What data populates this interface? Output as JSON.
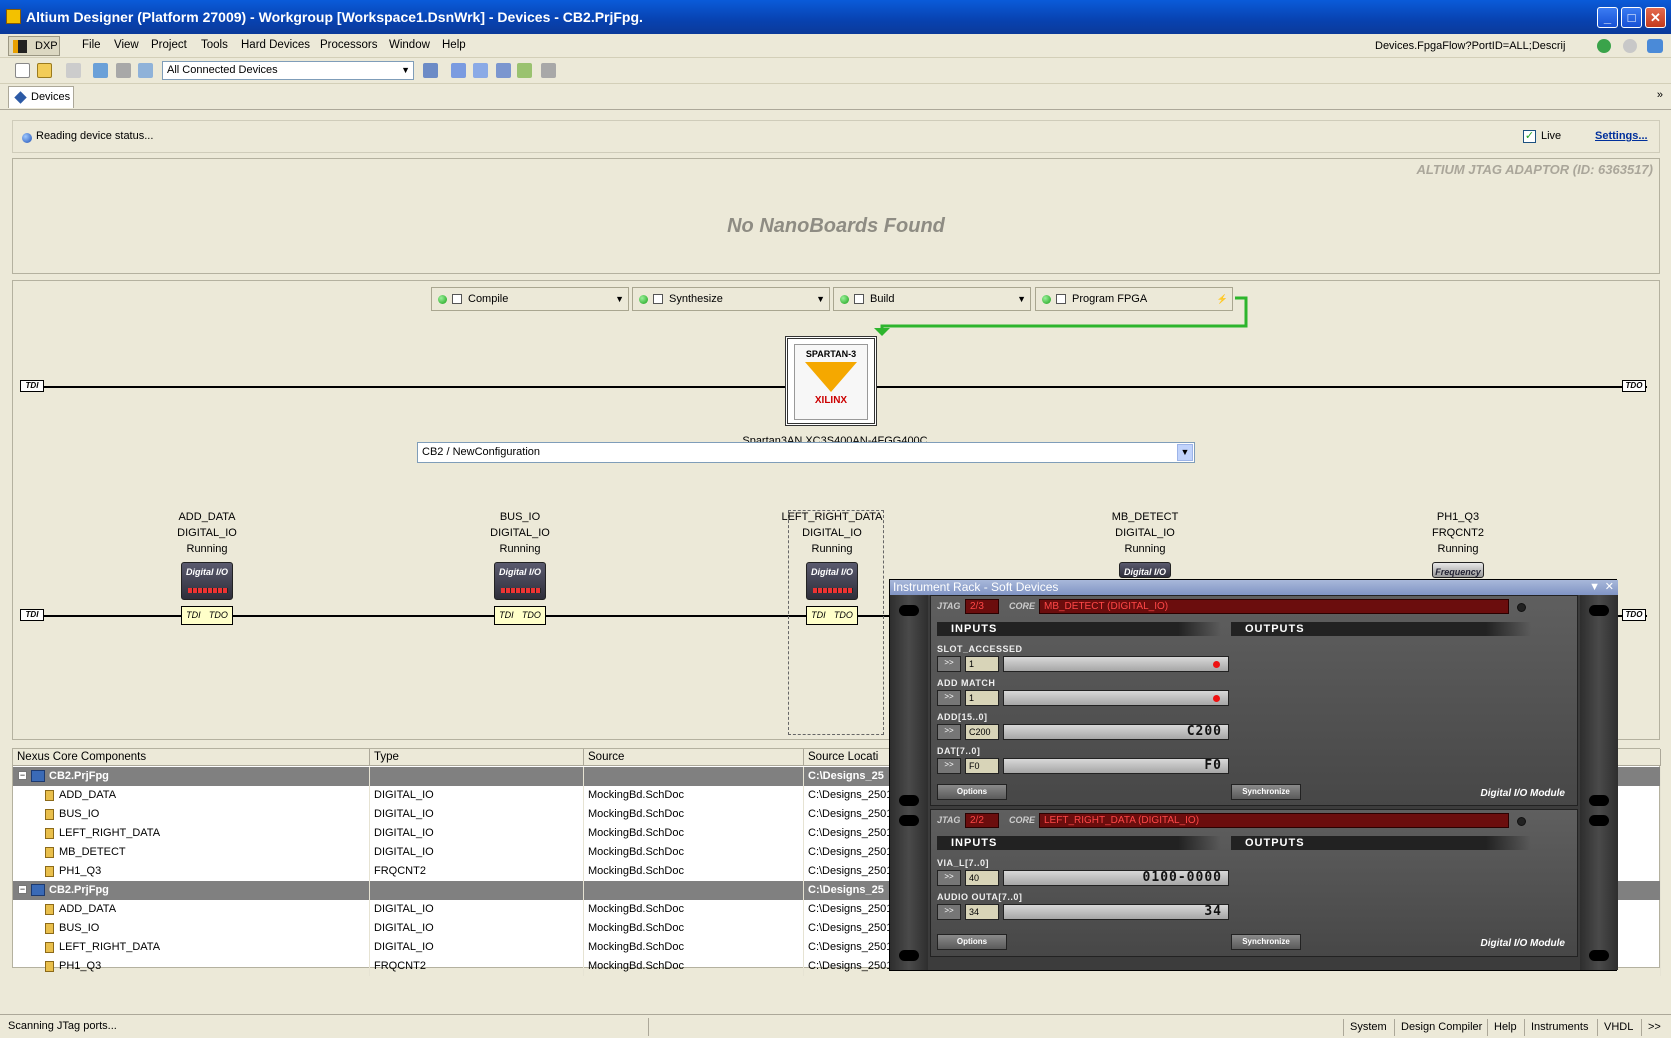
{
  "window": {
    "title": "Altium Designer (Platform 27009) - Workgroup [Workspace1.DsnWrk] - Devices - CB2.PrjFpg."
  },
  "menubar": {
    "dxp": "DXP",
    "items": [
      "File",
      "View",
      "Project",
      "Tools",
      "Hard Devices",
      "Processors",
      "Window",
      "Help"
    ],
    "nav_combo": "Devices.FpgaFlow?PortID=ALL;Descrij"
  },
  "toolbar": {
    "device_filter": "All Connected Devices"
  },
  "tabs": {
    "devices": "Devices"
  },
  "status_strip": {
    "message": "Reading device status...",
    "live_label": "Live",
    "live_checked": "✓",
    "settings": "Settings..."
  },
  "board_panel": {
    "adaptor": "ALTIUM JTAG ADAPTOR (ID: 6363517)",
    "message": "No NanoBoards Found"
  },
  "flow": {
    "compile": "Compile",
    "synthesize": "Synthesize",
    "build": "Build",
    "program": "Program FPGA"
  },
  "chain": {
    "tdi": "TDI",
    "tdo": "TDO"
  },
  "device": {
    "brand": "SPARTAN-3",
    "vendor": "XILINX",
    "name": "Spartan3AN XC3S400AN-4FGG400C",
    "state": "Programmed"
  },
  "configuration": "CB2 / NewConfiguration",
  "cores": [
    {
      "name": "ADD_DATA",
      "type": "DIGITAL_IO",
      "state": "Running",
      "icon": "Digital I/O"
    },
    {
      "name": "BUS_IO",
      "type": "DIGITAL_IO",
      "state": "Running",
      "icon": "Digital I/O"
    },
    {
      "name": "LEFT_RIGHT_DATA",
      "type": "DIGITAL_IO",
      "state": "Running",
      "icon": "Digital I/O"
    },
    {
      "name": "MB_DETECT",
      "type": "DIGITAL_IO",
      "state": "Running",
      "icon": "Digital I/O"
    },
    {
      "name": "PH1_Q3",
      "type": "FRQCNT2",
      "state": "Running",
      "icon": "Frequency"
    }
  ],
  "grid": {
    "headers": [
      "Nexus Core Components",
      "Type",
      "Source",
      "Source Locati"
    ],
    "groups": [
      {
        "name": "CB2.PrjFpg",
        "location": "C:\\Designs_25",
        "rows": [
          {
            "name": "ADD_DATA",
            "type": "DIGITAL_IO",
            "source": "MockingBd.SchDoc",
            "loc": "C:\\Designs_2501"
          },
          {
            "name": "BUS_IO",
            "type": "DIGITAL_IO",
            "source": "MockingBd.SchDoc",
            "loc": "C:\\Designs_2501"
          },
          {
            "name": "LEFT_RIGHT_DATA",
            "type": "DIGITAL_IO",
            "source": "MockingBd.SchDoc",
            "loc": "C:\\Designs_2501"
          },
          {
            "name": "MB_DETECT",
            "type": "DIGITAL_IO",
            "source": "MockingBd.SchDoc",
            "loc": "C:\\Designs_2501"
          },
          {
            "name": "PH1_Q3",
            "type": "FRQCNT2",
            "source": "MockingBd.SchDoc",
            "loc": "C:\\Designs_2501"
          }
        ]
      },
      {
        "name": "CB2.PrjFpg",
        "location": "C:\\Designs_25",
        "rows": [
          {
            "name": "ADD_DATA",
            "type": "DIGITAL_IO",
            "source": "MockingBd.SchDoc",
            "loc": "C:\\Designs_2501"
          },
          {
            "name": "BUS_IO",
            "type": "DIGITAL_IO",
            "source": "MockingBd.SchDoc",
            "loc": "C:\\Designs_2501"
          },
          {
            "name": "LEFT_RIGHT_DATA",
            "type": "DIGITAL_IO",
            "source": "MockingBd.SchDoc",
            "loc": "C:\\Designs_2501"
          },
          {
            "name": "PH1_Q3",
            "type": "FRQCNT2",
            "source": "MockingBd.SchDoc",
            "loc": "C:\\Designs_2501"
          }
        ]
      }
    ]
  },
  "rack": {
    "title": "Instrument Rack - Soft Devices",
    "modules": [
      {
        "jtag_label": "JTAG",
        "jtag": "2/3",
        "core_label": "CORE",
        "core": "MB_DETECT (DIGITAL_IO)",
        "inputs": "INPUTS",
        "outputs": "OUTPUTS",
        "signals": [
          {
            "label": "SLOT_ACCESSED",
            "btn": ">>",
            "value": "1",
            "display": ""
          },
          {
            "label": "ADD MATCH",
            "btn": ">>",
            "value": "1",
            "display": ""
          },
          {
            "label": "ADD[15..0]",
            "btn": ">>",
            "value": "C200",
            "display": "C200"
          },
          {
            "label": "DAT[7..0]",
            "btn": ">>",
            "value": "F0",
            "display": "F0"
          }
        ],
        "options": "Options",
        "sync": "Synchronize",
        "module": "Digital I/O Module"
      },
      {
        "jtag_label": "JTAG",
        "jtag": "2/2",
        "core_label": "CORE",
        "core": "LEFT_RIGHT_DATA (DIGITAL_IO)",
        "inputs": "INPUTS",
        "outputs": "OUTPUTS",
        "signals": [
          {
            "label": "VIA_L[7..0]",
            "btn": ">>",
            "value": "40",
            "display": "0100-0000"
          },
          {
            "label": "AUDIO OUTA[7..0]",
            "btn": ">>",
            "value": "34",
            "display": "34"
          }
        ],
        "options": "Options",
        "sync": "Synchronize",
        "module": "Digital I/O Module"
      }
    ]
  },
  "statusbar": {
    "message": "Scanning JTag ports...",
    "tabs": [
      "System",
      "Design Compiler",
      "Help",
      "Instruments",
      "VHDL"
    ],
    "more": ">>"
  },
  "colors": {
    "titlebar": "#0842b0",
    "gridgroup": "#808080",
    "rack": "#3c3c3c",
    "core_red": "#ff4747"
  }
}
